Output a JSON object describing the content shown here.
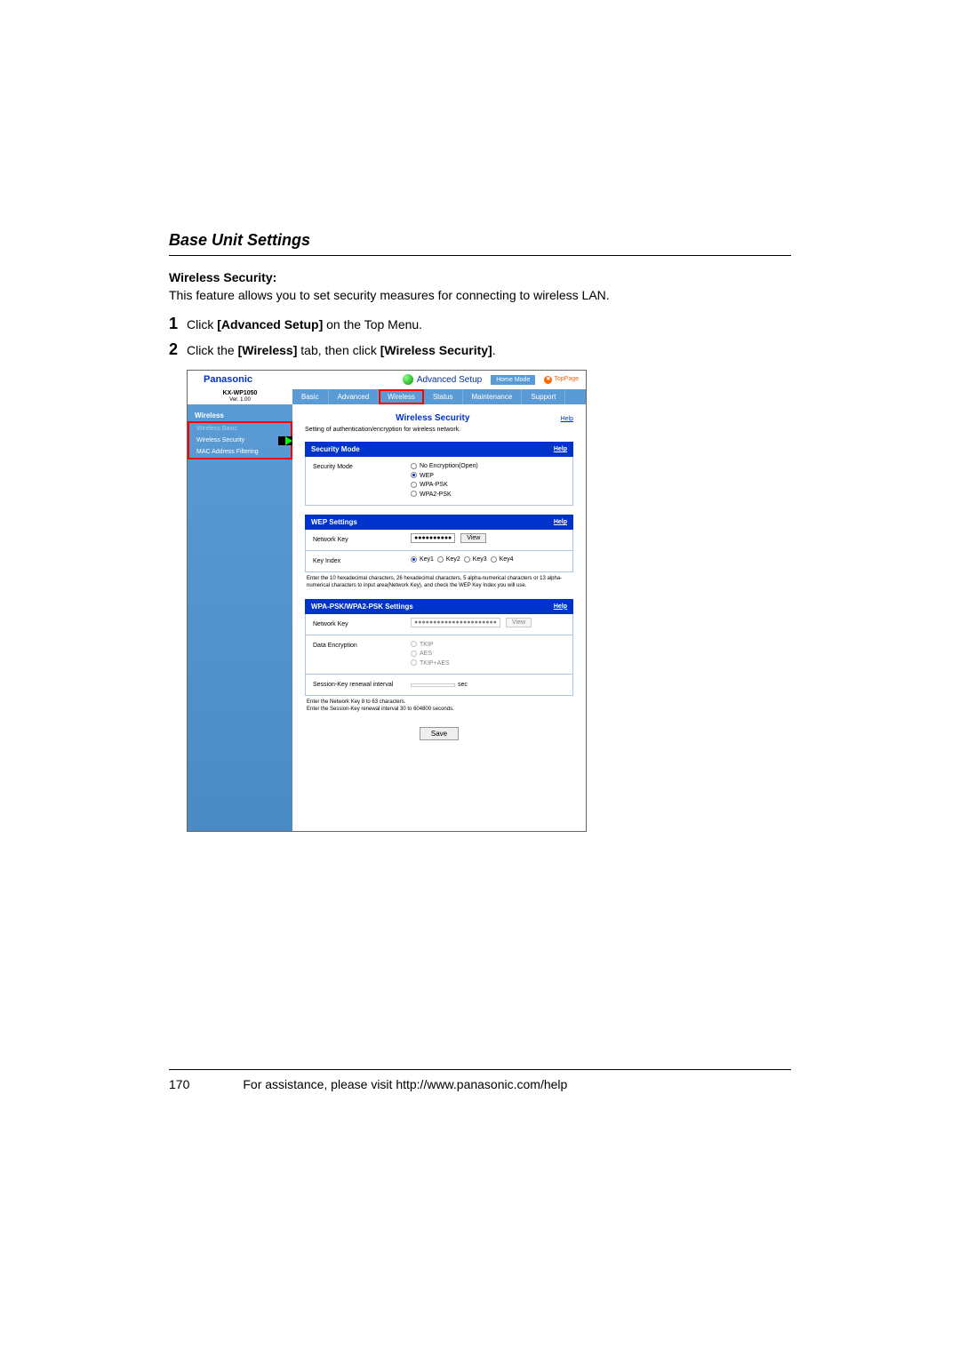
{
  "page": {
    "section_title": "Base Unit Settings",
    "subtitle": "Wireless Security:",
    "description": "This feature allows you to set security measures for connecting to wireless LAN.",
    "step1_num": "1",
    "step1_pre": "Click ",
    "step1_bold": "[Advanced Setup]",
    "step1_post": " on the Top Menu.",
    "step2_num": "2",
    "step2_pre": "Click the ",
    "step2_bold1": "[Wireless]",
    "step2_mid": " tab, then click ",
    "step2_bold2": "[Wireless Security]",
    "step2_post": "."
  },
  "screenshot": {
    "brand": "Panasonic",
    "setup_label": "Advanced Setup",
    "home_mode": "Home Mode",
    "toppage": "TopPage",
    "model": "KX-WP1050",
    "version": "Ver. 1.00",
    "tabs": {
      "basic": "Basic",
      "advanced": "Advanced",
      "wireless": "Wireless",
      "status": "Status",
      "maintenance": "Maintenance",
      "support": "Support"
    },
    "sidebar": {
      "heading": "Wireless",
      "item_basic": "Wireless Basic",
      "item_security": "Wireless Security",
      "item_mac": "MAC Address Filtering"
    },
    "panel": {
      "title": "Wireless Security",
      "help": "Help",
      "subtitle": "Setting of authentication/encryption for wireless network."
    },
    "sec_mode": {
      "bar": "Security Mode",
      "help": "Help",
      "label": "Security Mode",
      "opt1": "No Encryption(Open)",
      "opt2": "WEP",
      "opt3": "WPA-PSK",
      "opt4": "WPA2-PSK"
    },
    "wep": {
      "bar": "WEP Settings",
      "help": "Help",
      "netkey_label": "Network Key",
      "netkey_value": "●●●●●●●●●●",
      "view": "View",
      "keyidx_label": "Key Index",
      "k1": "Key1",
      "k2": "Key2",
      "k3": "Key3",
      "k4": "Key4",
      "note": "Enter the 10 hexadecimal characters, 26 hexadecimal characters, 5 alpha-numerical characters or 13 alpha-numerical characters to input area(Network Key), and check the WEP Key Index you will use."
    },
    "wpa": {
      "bar": "WPA-PSK/WPA2-PSK Settings",
      "help": "Help",
      "netkey_label": "Network Key",
      "netkey_value": "●●●●●●●●●●●●●●●●●●●●●●",
      "view": "View",
      "enc_label": "Data Encryption",
      "enc1": "TKIP",
      "enc2": "AES",
      "enc3": "TKIP+AES",
      "session_label": "Session-Key renewal interval",
      "sec": "sec",
      "note1": "Enter the Network Key 8 to 63 characters.",
      "note2": "Enter the Session-Key renewal interval 30 to 604800 seconds."
    },
    "save": "Save"
  },
  "footer": {
    "page_num": "170",
    "text": "For assistance, please visit http://www.panasonic.com/help"
  }
}
